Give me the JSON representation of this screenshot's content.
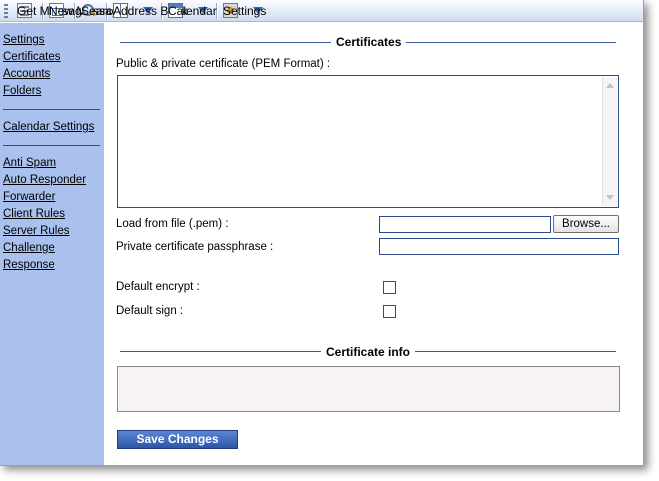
{
  "toolbar": {
    "items": [
      {
        "label": "Get Messages",
        "icon": "get-messages-icon"
      },
      {
        "label": "New Message",
        "icon": "new-message-icon"
      },
      {
        "label": "Search",
        "icon": "search-icon"
      },
      {
        "label": "Address Book",
        "icon": "address-book-icon"
      },
      {
        "label": "Calendar",
        "icon": "calendar-icon"
      },
      {
        "label": "Settings",
        "icon": "settings-icon"
      }
    ]
  },
  "sidebar": {
    "group1": [
      "Settings",
      "Certificates",
      "Accounts",
      "Folders"
    ],
    "group2": [
      "Calendar Settings"
    ],
    "group3": [
      "Anti Spam",
      "Auto Responder",
      "Forwarder",
      "Client Rules",
      "Server Rules",
      "Challenge Response"
    ]
  },
  "main": {
    "certificates_title": "Certificates",
    "pem_label": "Public & private certificate (PEM Format) :",
    "pem_value": "",
    "load_label": "Load from file (.pem) :",
    "load_value": "",
    "browse_label": "Browse...",
    "passphrase_label": "Private certificate passphrase :",
    "passphrase_value": "",
    "default_encrypt_label": "Default encrypt :",
    "default_encrypt_checked": false,
    "default_sign_label": "Default sign :",
    "default_sign_checked": false,
    "certificate_info_title": "Certificate info",
    "certificate_info_value": "",
    "save_label": "Save Changes"
  },
  "colors": {
    "sidebar_bg": "#a9c1ec",
    "accent": "#3566c7",
    "save_button": "#2c55a8",
    "border": "#2c4c88"
  }
}
